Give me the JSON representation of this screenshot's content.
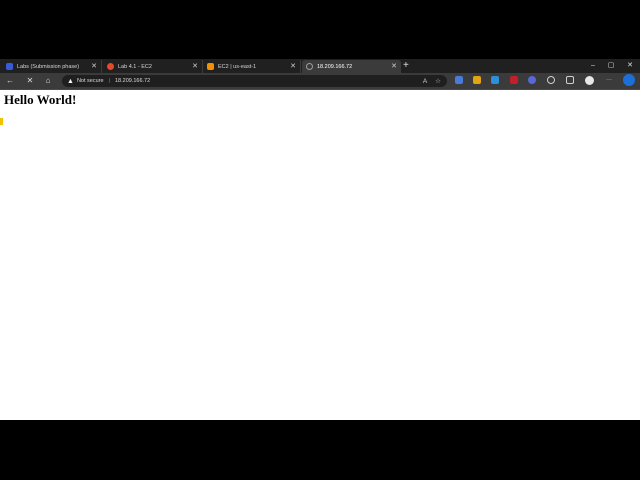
{
  "tabs": [
    {
      "title": "Labs (Submission phase)",
      "favicon_color": "#3a5bd9"
    },
    {
      "title": "Lab 4.1 - EC2",
      "favicon_color": "#e04a2f"
    },
    {
      "title": "EC2 | us-east-1",
      "favicon_color": "#f29100"
    },
    {
      "title": "18.209.166.72",
      "favicon_color": "#9e9e9e",
      "active": true
    }
  ],
  "new_tab": "+",
  "window_controls": {
    "minimize": "–",
    "maximize": "▢",
    "close": "✕"
  },
  "toolbar": {
    "back": "←",
    "stop": "✕",
    "home": "⌂",
    "security_label": "Not secure",
    "url": "18.209.166.72",
    "read_aloud": "A",
    "favorite": "☆",
    "more": "···"
  },
  "page": {
    "heading": "Hello World!"
  }
}
